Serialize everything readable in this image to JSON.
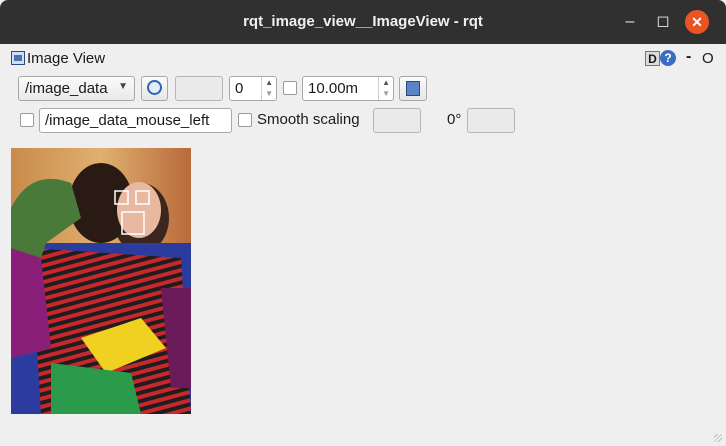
{
  "window": {
    "title": "rqt_image_view__ImageView - rqt",
    "minimize_glyph": "–",
    "maximize_glyph": "◻",
    "close_glyph": "✕"
  },
  "dock": {
    "title": "Image View",
    "d_label": "D",
    "help_label": "?",
    "minimize_label": "-",
    "close_label": "O"
  },
  "toolbar": {
    "topic_selected": "/image_data",
    "refresh_icon": "refresh-icon",
    "number_value": "0",
    "max_value": "10.00m",
    "save_icon": "save-icon"
  },
  "row2": {
    "mouse_topic_value": "/image_data_mouse_left",
    "smooth_label": "Smooth scaling",
    "rotation_label": "0°"
  },
  "image": {
    "description_icon": "camera-image",
    "face_boxes": 3
  },
  "colors": {
    "titlebar": "#303030",
    "close_button": "#e95420",
    "background": "#efefef"
  }
}
